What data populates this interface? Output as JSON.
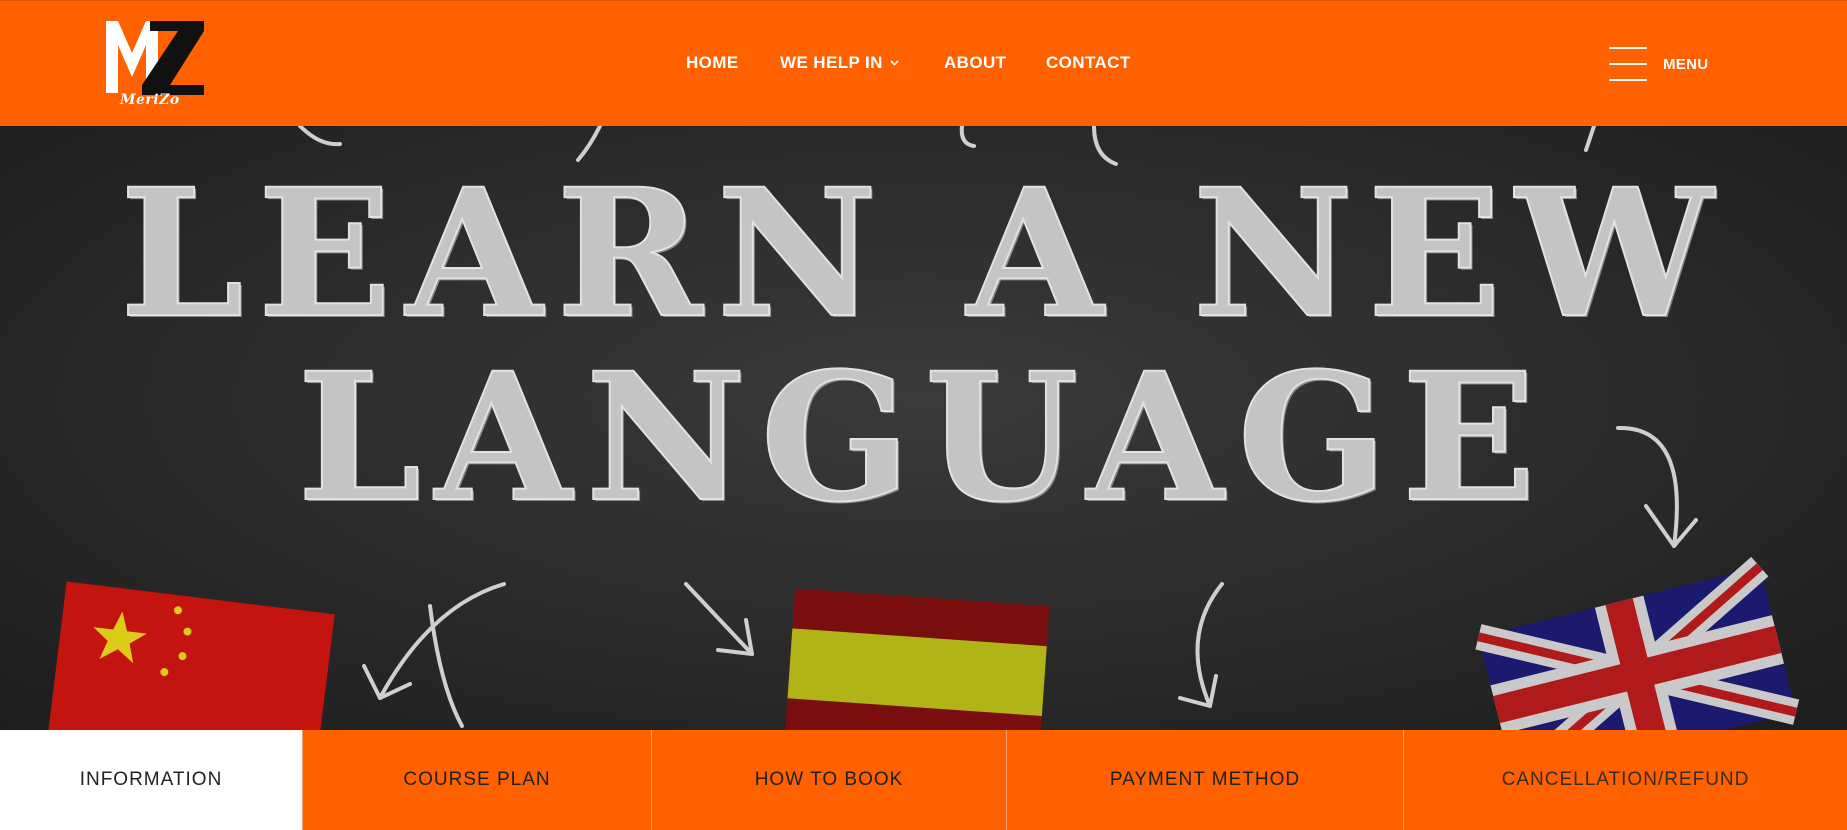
{
  "brand": {
    "logo_letters": "MZ",
    "sub_text": "MeriZo",
    "colors": {
      "primary": "#ff6100",
      "text_light": "#ffffff",
      "dark": "#111111"
    }
  },
  "nav": {
    "items": [
      {
        "label": "HOME"
      },
      {
        "label": "WE HELP IN",
        "icon": "chevron-down-icon"
      },
      {
        "label": "ABOUT"
      },
      {
        "label": "CONTACT"
      }
    ],
    "menu_label": "MENU",
    "menu_icon": "hamburger-icon"
  },
  "hero": {
    "line1": "LEARN A NEW",
    "line2": "LANGUAGE",
    "flags": [
      "china-flag",
      "spain-flag",
      "uk-flag"
    ]
  },
  "tabs": [
    {
      "label": "INFORMATION",
      "active": true
    },
    {
      "label": "COURSE PLAN"
    },
    {
      "label": "HOW TO BOOK"
    },
    {
      "label": "PAYMENT METHOD"
    },
    {
      "label": "CANCELLATION/REFUND"
    }
  ]
}
